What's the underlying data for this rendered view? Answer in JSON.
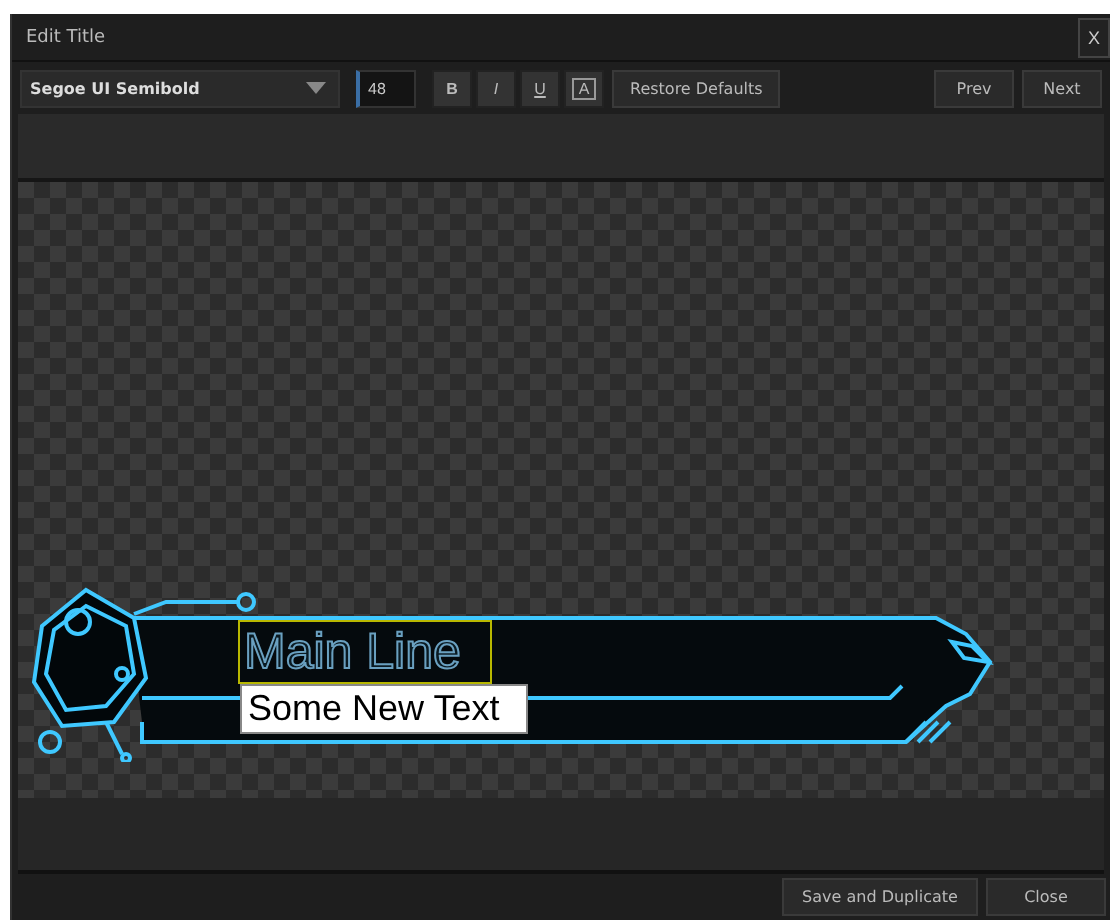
{
  "window": {
    "title": "Edit Title",
    "close": "X"
  },
  "toolbar": {
    "font": "Segoe UI Semibold",
    "size": "48",
    "format_buttons": [
      {
        "label": "B",
        "kind": "bold"
      },
      {
        "label": "I",
        "kind": "italic"
      },
      {
        "label": "U",
        "kind": "underline"
      },
      {
        "label": "A",
        "kind": "outline"
      }
    ],
    "restore": "Restore Defaults",
    "prev": "Prev",
    "next": "Next"
  },
  "canvas": {
    "main_line": "Main Line",
    "editor_value": "Some New Text"
  },
  "buttons": [
    "Save and Duplicate",
    "Close"
  ]
}
